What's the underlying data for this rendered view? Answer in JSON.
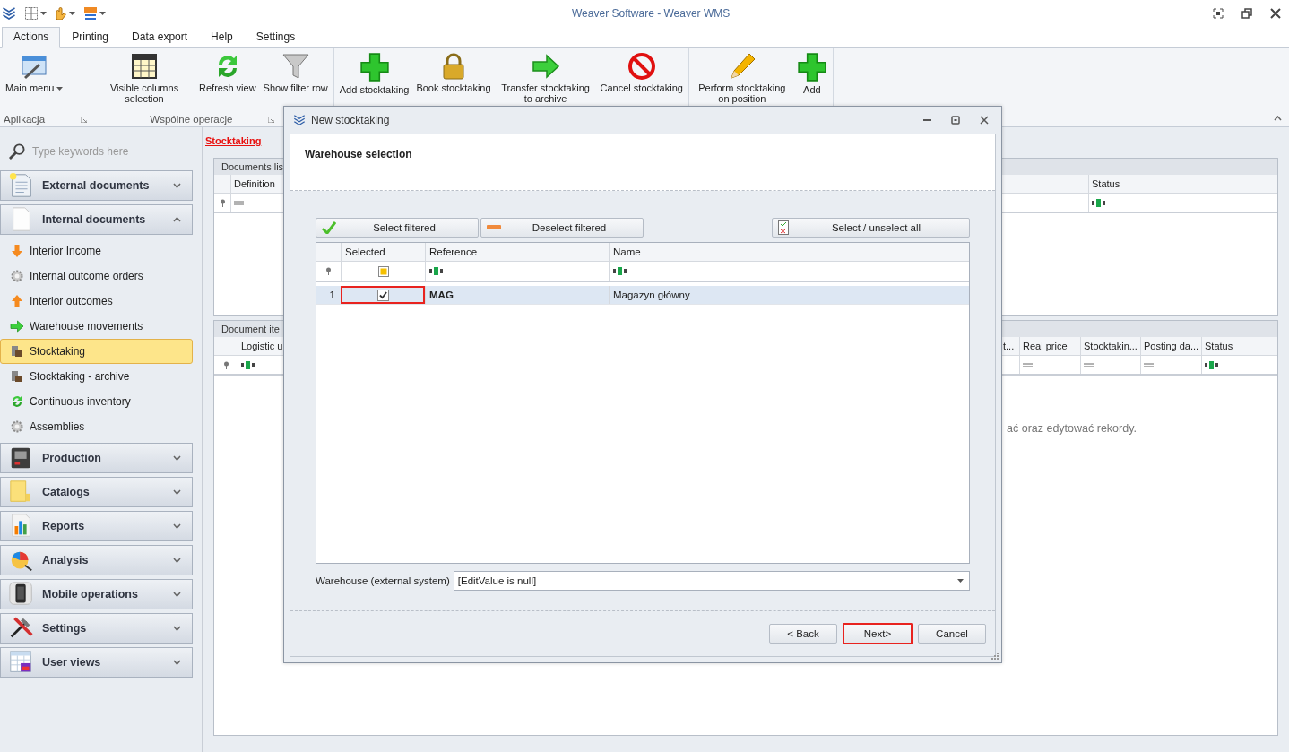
{
  "title_bar": {
    "title": "Weaver Software - Weaver WMS"
  },
  "ribbon_tabs": [
    {
      "label": "Actions",
      "selected": true
    },
    {
      "label": "Printing",
      "selected": false
    },
    {
      "label": "Data export",
      "selected": false
    },
    {
      "label": "Help",
      "selected": false
    },
    {
      "label": "Settings",
      "selected": false
    }
  ],
  "ribbon_groups": [
    {
      "label": "Aplikacja",
      "buttons": [
        {
          "label": "Main menu",
          "dropdown": true
        }
      ]
    },
    {
      "label": "Wspólne operacje",
      "buttons": [
        {
          "label": "Visible columns selection",
          "dropdown": false
        },
        {
          "label": "Refresh view",
          "dropdown": false
        },
        {
          "label": "Show filter row",
          "dropdown": false
        }
      ]
    },
    {
      "buttons": [
        {
          "label": "Add stocktaking",
          "dropdown": false
        },
        {
          "label": "Book stocktaking",
          "dropdown": false
        },
        {
          "label": "Transfer stocktaking to archive",
          "dropdown": false
        },
        {
          "label": "Cancel stocktaking",
          "dropdown": false
        }
      ]
    },
    {
      "buttons": [
        {
          "label": "Perform stocktaking on position",
          "dropdown": false
        },
        {
          "label": "Add",
          "dropdown": false
        }
      ]
    }
  ],
  "sidebar": {
    "search": {
      "placeholder": "Type keywords here"
    },
    "groups": [
      {
        "label": "External documents",
        "expanded": false
      },
      {
        "label": "Internal documents",
        "expanded": true,
        "items": [
          {
            "label": "Interior Income",
            "selected": false
          },
          {
            "label": "Internal outcome orders",
            "selected": false
          },
          {
            "label": "Interior outcomes",
            "selected": false
          },
          {
            "label": "Warehouse movements",
            "selected": false
          },
          {
            "label": "Stocktaking",
            "selected": true
          },
          {
            "label": "Stocktaking - archive",
            "selected": false
          },
          {
            "label": "Continuous inventory",
            "selected": false
          },
          {
            "label": "Assemblies",
            "selected": false
          }
        ]
      },
      {
        "label": "Production",
        "expanded": false
      },
      {
        "label": "Catalogs",
        "expanded": false
      },
      {
        "label": "Reports",
        "expanded": false
      },
      {
        "label": "Analysis",
        "expanded": false
      },
      {
        "label": "Mobile operations",
        "expanded": false
      },
      {
        "label": "Settings",
        "expanded": false
      },
      {
        "label": "User views",
        "expanded": false
      }
    ]
  },
  "breadcrumb": "Stocktaking",
  "documents_list": {
    "title": "Documents lis",
    "left_columns": [
      {
        "label": "Definition"
      }
    ],
    "right_columns": [
      {
        "label": "Status"
      }
    ]
  },
  "document_items": {
    "title": "Document ite",
    "left_columns": [
      {
        "label": "Logistic u"
      }
    ],
    "right_columns": [
      {
        "label": "t..."
      },
      {
        "label": "Real price"
      },
      {
        "label": "Stocktakin..."
      },
      {
        "label": "Posting da..."
      },
      {
        "label": "Status"
      }
    ],
    "message": "ać oraz edytować rekordy."
  },
  "dialog": {
    "title": "New stocktaking",
    "heading": "Warehouse selection",
    "buttons": [
      "Select filtered",
      "Deselect filtered",
      "Select / unselect all"
    ],
    "grid": {
      "columns": [
        "Selected",
        "Reference",
        "Name"
      ],
      "rows": [
        {
          "number": "1",
          "selected": true,
          "checked": true,
          "highlighted": true,
          "reference": "MAG",
          "name": "Magazyn główny"
        }
      ]
    },
    "warehouse_field": {
      "label": "Warehouse (external system)",
      "value": "[EditValue is null]"
    },
    "footer_buttons": [
      {
        "label": "< Back",
        "highlighted": false
      },
      {
        "label": "Next>",
        "highlighted": true
      },
      {
        "label": "Cancel",
        "highlighted": false
      }
    ]
  }
}
